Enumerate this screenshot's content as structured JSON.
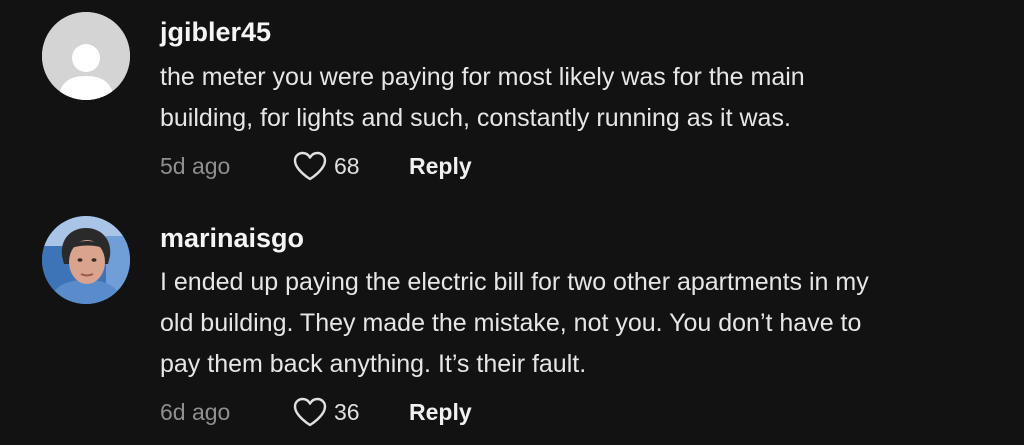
{
  "comments": [
    {
      "username": "jgibler45",
      "text_line1": "the meter you were paying for most likely was for the main",
      "text_line2": "building, for lights and such, constantly running as it was.",
      "time": "5d ago",
      "likes": "68",
      "reply_label": "Reply",
      "avatar": "default-avatar-icon"
    },
    {
      "username": "marinaisgo",
      "text_line1": "I ended up paying the electric bill for two other apartments in my",
      "text_line2": "old building. They made the mistake, not you. You don’t have to",
      "text_line3": "pay them back anything. It’s their fault.",
      "time": "6d ago",
      "likes": "36",
      "reply_label": "Reply",
      "avatar": "user-photo"
    }
  ],
  "colors": {
    "background": "#121212",
    "text": "#e6e6e6",
    "muted": "#8f8f8f"
  },
  "icons": {
    "like": "heart-outline-icon"
  }
}
